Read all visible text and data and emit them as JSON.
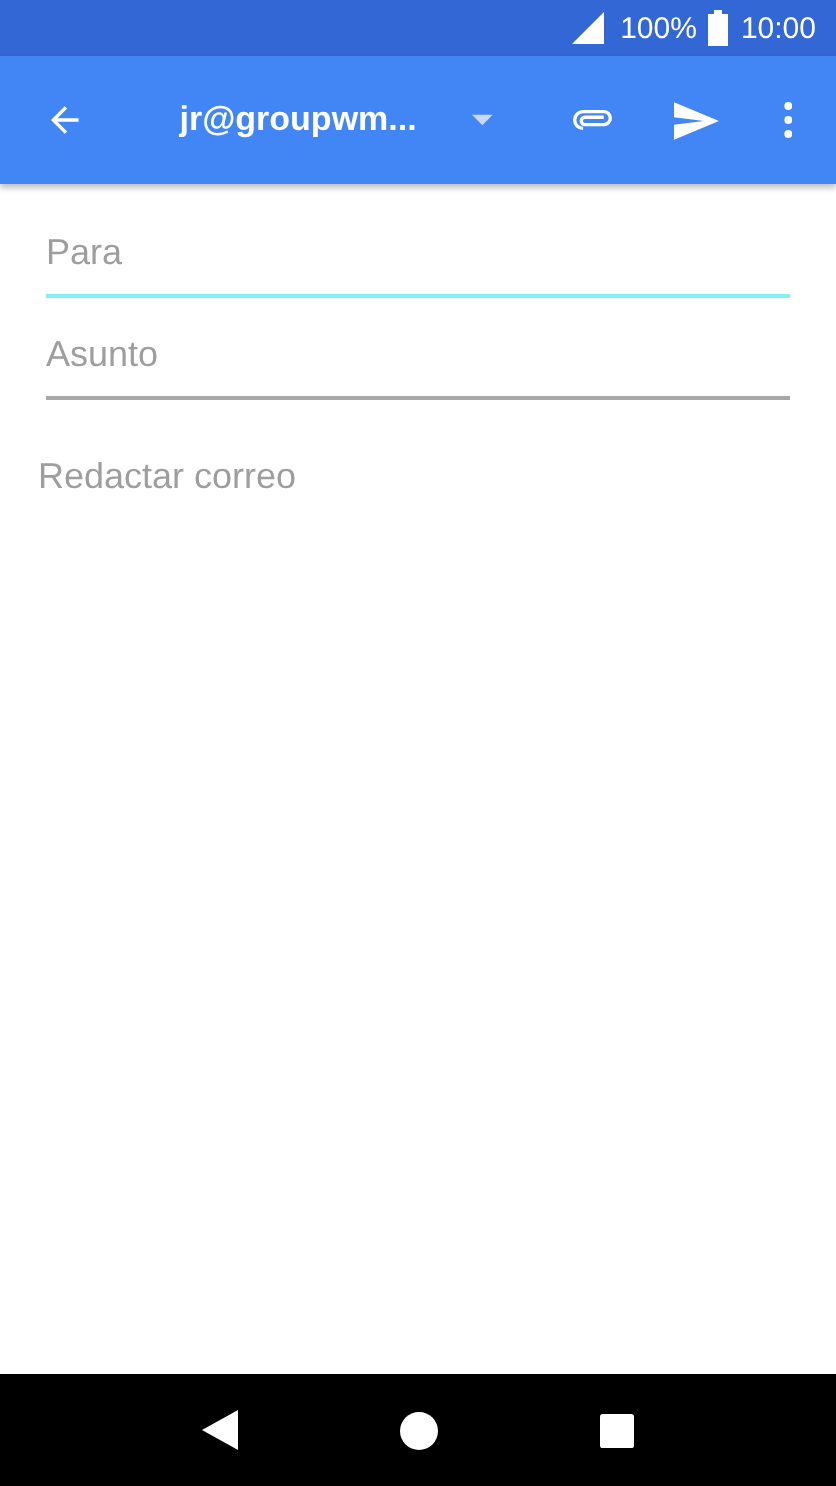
{
  "status_bar": {
    "battery": "100%",
    "time": "10:00"
  },
  "toolbar": {
    "account": "jr@groupwm..."
  },
  "fields": [
    {
      "placeholder": "Para",
      "focused": true
    },
    {
      "placeholder": "Asunto",
      "focused": false
    }
  ],
  "body": {
    "placeholder": "Redactar correo"
  }
}
